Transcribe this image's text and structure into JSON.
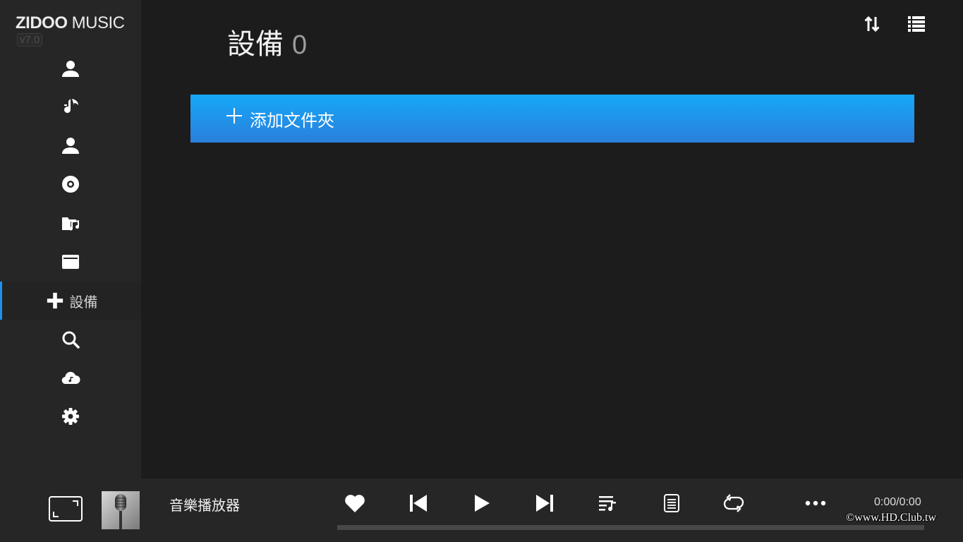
{
  "app": {
    "brand_bold": "ZIDOO",
    "brand_light": " MUSIC",
    "version": "v7.0"
  },
  "sidebar": {
    "items": [
      {
        "icon": "user-icon"
      },
      {
        "icon": "music-note-icon"
      },
      {
        "icon": "artist-icon"
      },
      {
        "icon": "disc-icon"
      },
      {
        "icon": "music-folder-icon"
      },
      {
        "icon": "folder-icon"
      },
      {
        "icon": "plus-icon",
        "label": "設備",
        "active": true
      },
      {
        "icon": "search-icon"
      },
      {
        "icon": "cloud-music-icon"
      },
      {
        "icon": "gear-icon"
      }
    ]
  },
  "header": {
    "title": "設備",
    "count": "0"
  },
  "add_folder": {
    "label": "添加文件夾"
  },
  "player": {
    "track_title": "音樂播放器",
    "time": "0:00/0:00",
    "progress": 0
  },
  "watermark": "©www.HD.Club.tw",
  "colors": {
    "accent": "#1e90ee",
    "banner_top": "#16a8f7",
    "banner_bottom": "#2a7fdc",
    "background": "#1c1c1d",
    "sidebar": "#262627"
  }
}
